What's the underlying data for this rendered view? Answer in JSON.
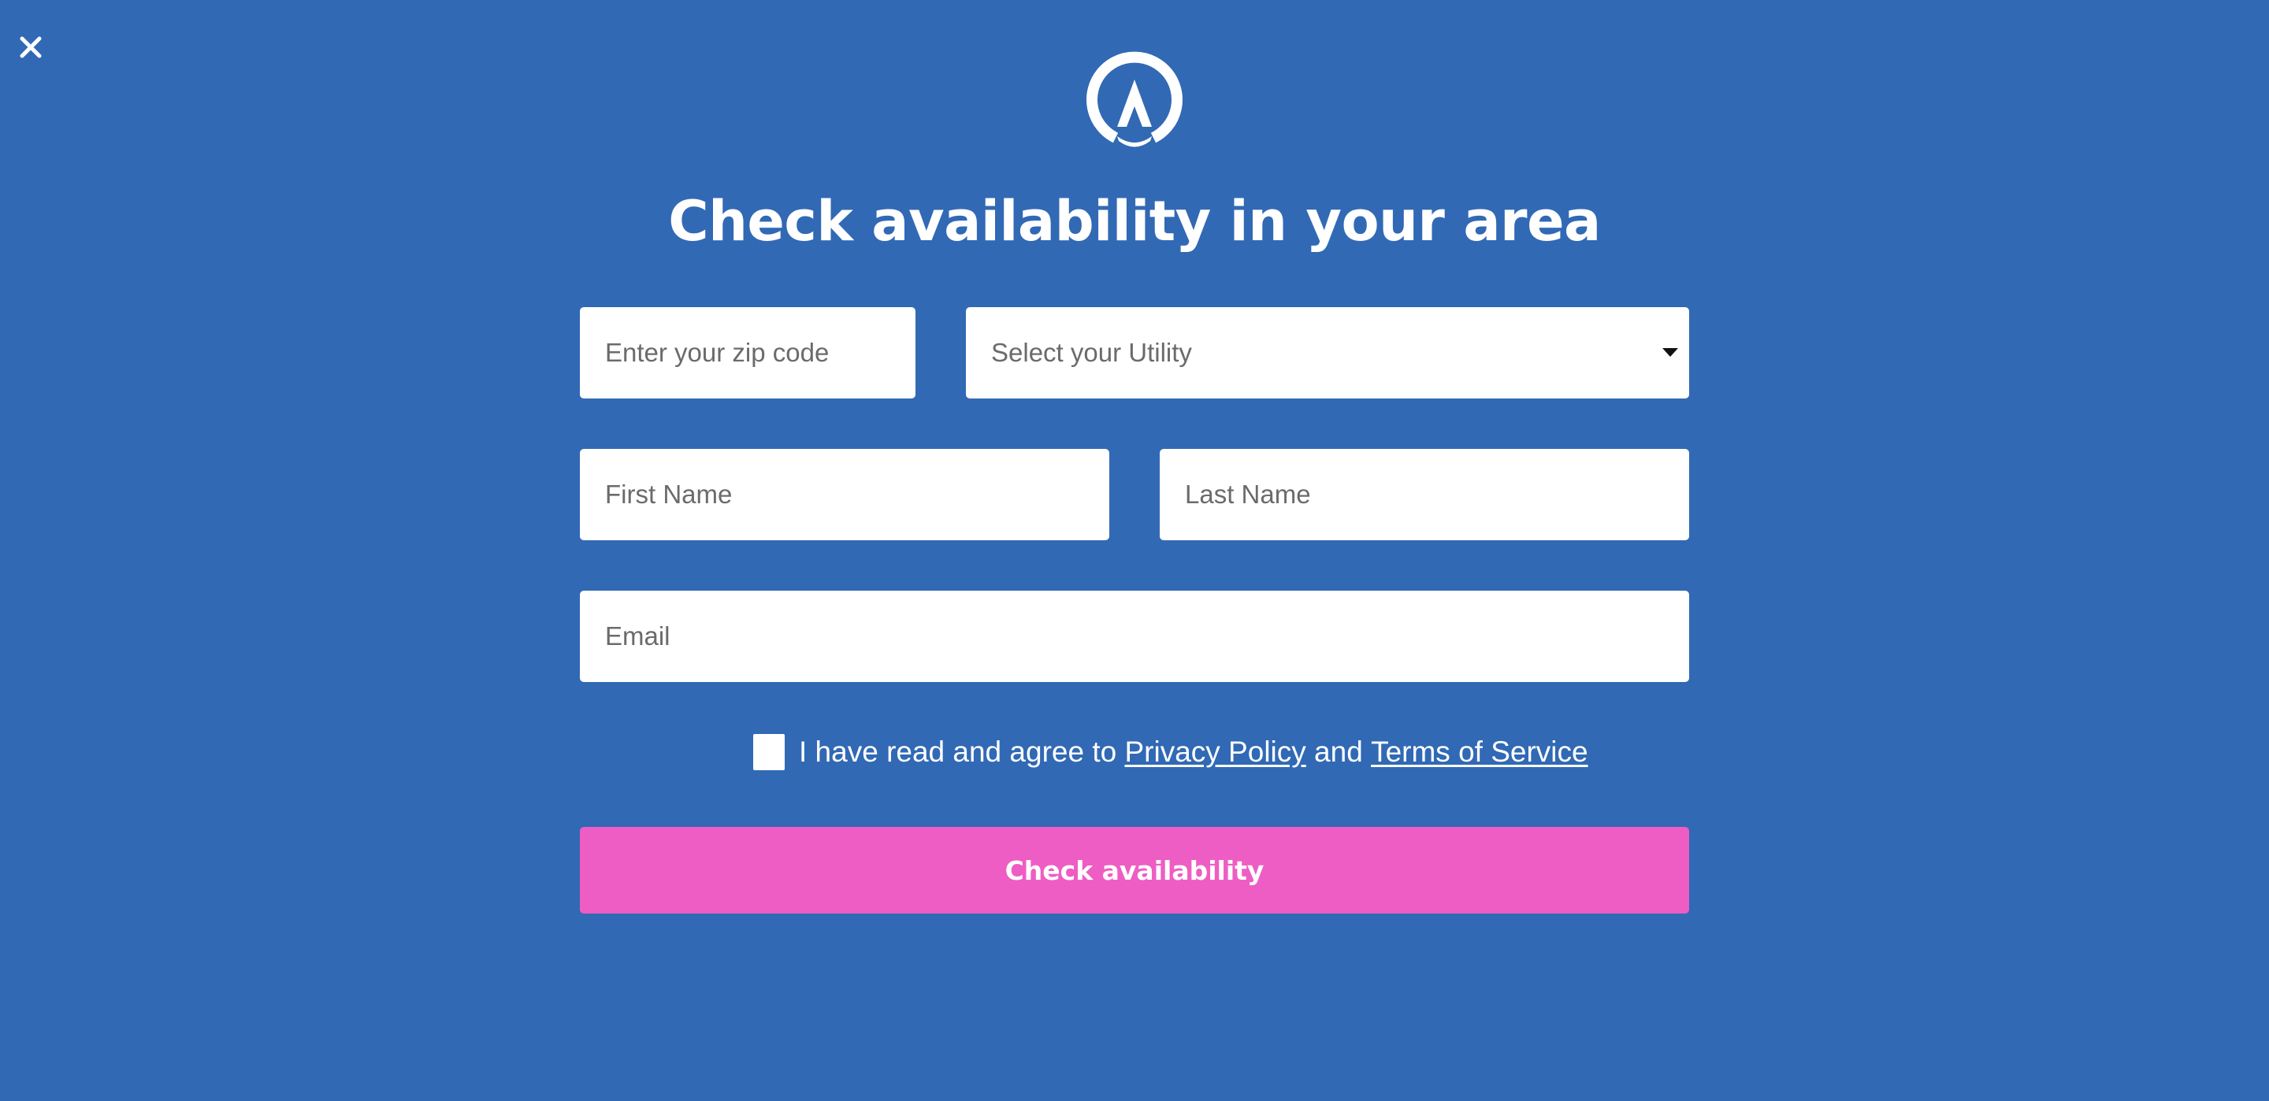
{
  "close": {
    "icon": "close-icon"
  },
  "logo": {
    "icon": "brand-logo-icon"
  },
  "title": "Check availability in your area",
  "form": {
    "zip": {
      "placeholder": "Enter your zip code",
      "value": ""
    },
    "utility": {
      "selected": "Select your Utility",
      "icon": "chevron-down-icon"
    },
    "first_name": {
      "placeholder": "First Name",
      "value": ""
    },
    "last_name": {
      "placeholder": "Last Name",
      "value": ""
    },
    "email": {
      "placeholder": "Email",
      "value": ""
    },
    "consent": {
      "checked": false,
      "text_prefix": "I have read and agree to",
      "privacy_link": "Privacy Policy",
      "conjunction": "and",
      "terms_link": "Terms of Service"
    },
    "submit_label": "Check availability"
  },
  "colors": {
    "background": "#3169b5",
    "button": "#ee5dc3",
    "field": "#ffffff",
    "text": "#ffffff"
  }
}
